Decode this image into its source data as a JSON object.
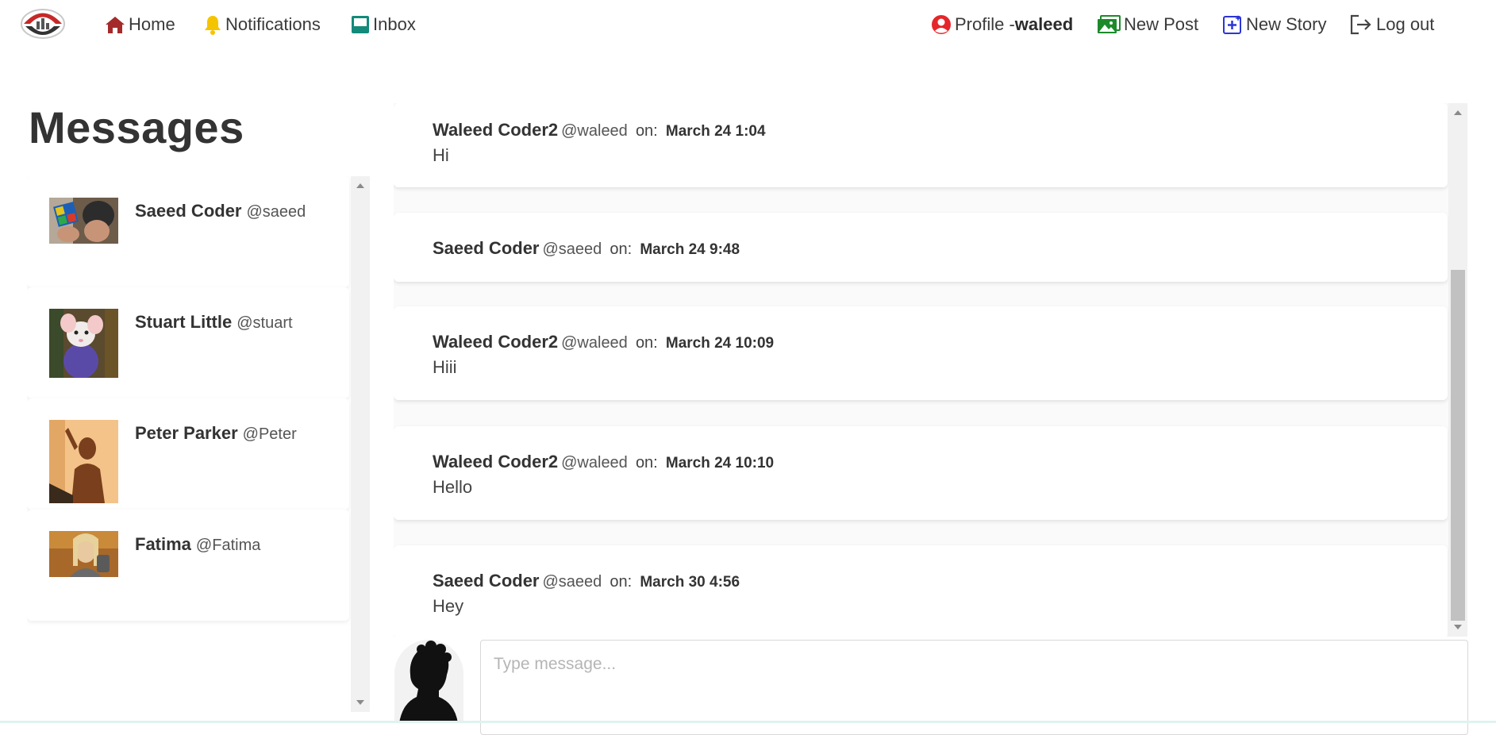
{
  "nav": {
    "home_label": "Home",
    "notifications_label": "Notifications",
    "inbox_label": "Inbox",
    "profile_prefix": "Profile -",
    "profile_username": "waleed",
    "new_post_label": "New Post",
    "new_story_label": "New Story",
    "logout_label": "Log out",
    "colors": {
      "home": "#a52a2a",
      "notifications": "#f5c400",
      "inbox": "#138a7a",
      "profile": "#e5262a",
      "new_post": "#1c8a2a",
      "new_story": "#2b35d8",
      "logout": "#444444"
    }
  },
  "page": {
    "title": "Messages"
  },
  "contacts": [
    {
      "name": "Saeed Coder",
      "handle": "@saeed",
      "avatar": "rubiks-cube-photo"
    },
    {
      "name": "Stuart Little",
      "handle": "@stuart",
      "avatar": "mouse-photo"
    },
    {
      "name": "Peter Parker",
      "handle": "@Peter",
      "avatar": "shadow-photo"
    },
    {
      "name": "Fatima",
      "handle": "@Fatima",
      "avatar": "woman-photo"
    }
  ],
  "messages": [
    {
      "name": "Waleed Coder2",
      "handle": "@waleed",
      "on": "on:",
      "time": "March 24 1:04",
      "text": "Hi"
    },
    {
      "name": "Saeed Coder",
      "handle": "@saeed",
      "on": "on:",
      "time": "March 24 9:48",
      "text": ""
    },
    {
      "name": "Waleed Coder2",
      "handle": "@waleed",
      "on": "on:",
      "time": "March 24 10:09",
      "text": "Hiii"
    },
    {
      "name": "Waleed Coder2",
      "handle": "@waleed",
      "on": "on:",
      "time": "March 24 10:10",
      "text": "Hello"
    },
    {
      "name": "Saeed Coder",
      "handle": "@saeed",
      "on": "on:",
      "time": "March 30 4:56",
      "text": "Hey"
    }
  ],
  "compose": {
    "placeholder": "Type message..."
  }
}
